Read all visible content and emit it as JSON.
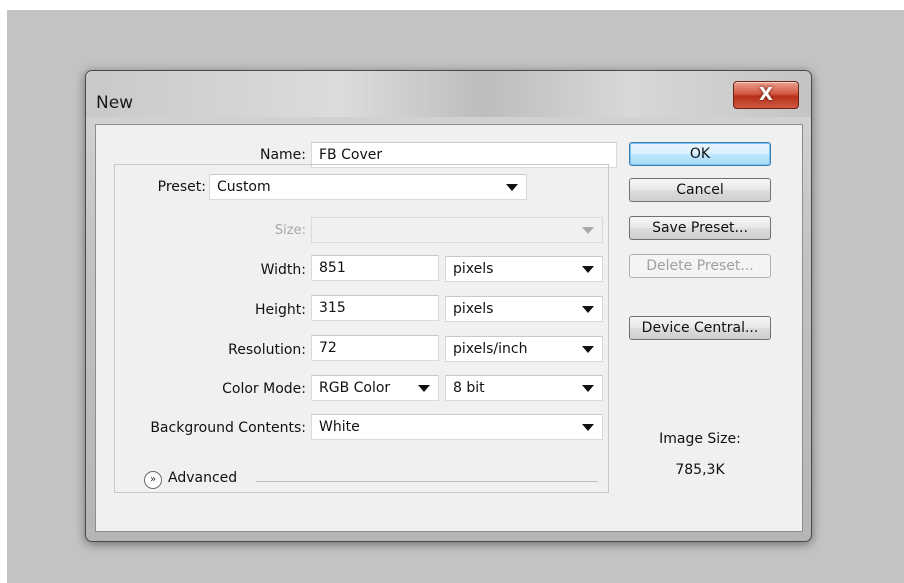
{
  "window": {
    "title": "New",
    "close_glyph": "X"
  },
  "form": {
    "name_label": "Name:",
    "name_value": "FB Cover",
    "preset_label": "Preset:",
    "preset_value": "Custom",
    "size_label": "Size:",
    "size_value": "",
    "width_label": "Width:",
    "width_value": "851",
    "width_unit": "pixels",
    "height_label": "Height:",
    "height_value": "315",
    "height_unit": "pixels",
    "resolution_label": "Resolution:",
    "resolution_value": "72",
    "resolution_unit": "pixels/inch",
    "color_mode_label": "Color Mode:",
    "color_mode_value": "RGB Color",
    "bit_depth_value": "8 bit",
    "background_label": "Background Contents:",
    "background_value": "White",
    "advanced_label": "Advanced"
  },
  "buttons": {
    "ok": "OK",
    "cancel": "Cancel",
    "save_preset": "Save Preset...",
    "delete_preset": "Delete Preset...",
    "device_central": "Device Central..."
  },
  "image_size": {
    "label": "Image Size:",
    "value": "785,3K"
  },
  "icons": {
    "dropdown": "chevron-down-icon",
    "advanced": "double-chevron-down-icon",
    "close": "close-icon"
  },
  "colors": {
    "accent_default_button": "#a7d9f5",
    "close_button": "#c43a22",
    "dialog_bg": "#f0f0f0"
  }
}
